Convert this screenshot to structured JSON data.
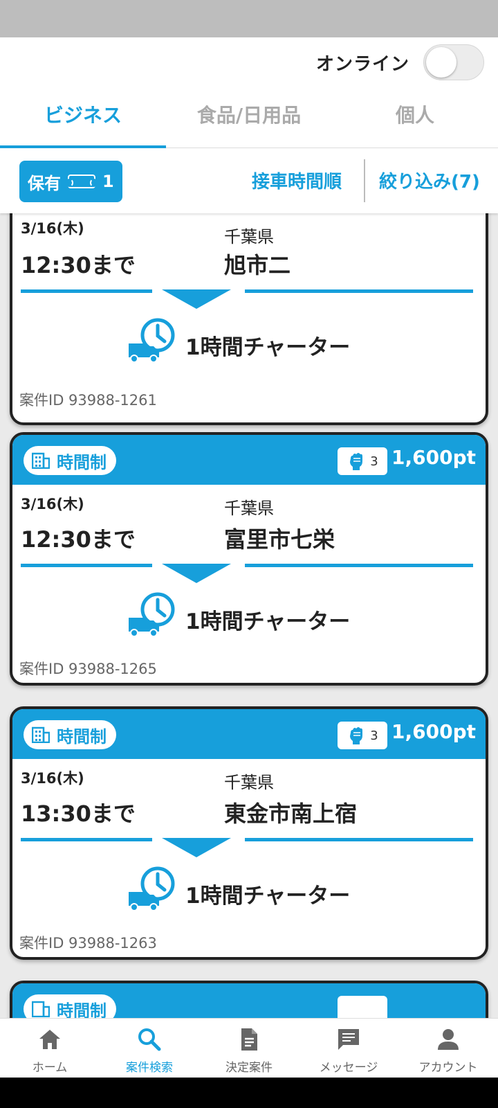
{
  "header": {
    "online_label": "オンライン",
    "online_enabled": false,
    "tabs": [
      {
        "label": "ビジネス",
        "active": true
      },
      {
        "label": "食品/日用品",
        "active": false
      },
      {
        "label": "個人",
        "active": false
      }
    ]
  },
  "filter_bar": {
    "owned_label": "保有",
    "owned_count": "1",
    "sort_label": "接車時間順",
    "filter_label": "絞り込み(7)"
  },
  "cards": [
    {
      "type_label": "",
      "fist_count": "",
      "points": "",
      "date": "3/16(木)",
      "deadline": "12:30まで",
      "prefecture": "千葉県",
      "city": "旭市二",
      "service": "1時間チャーター",
      "case_id": "案件ID 93988-1261"
    },
    {
      "type_label": "時間制",
      "fist_count": "3",
      "points": "1,600pt",
      "date": "3/16(木)",
      "deadline": "12:30まで",
      "prefecture": "千葉県",
      "city": "富里市七栄",
      "service": "1時間チャーター",
      "case_id": "案件ID 93988-1265"
    },
    {
      "type_label": "時間制",
      "fist_count": "3",
      "points": "1,600pt",
      "date": "3/16(木)",
      "deadline": "13:30まで",
      "prefecture": "千葉県",
      "city": "東金市南上宿",
      "service": "1時間チャーター",
      "case_id": "案件ID 93988-1263"
    },
    {
      "type_label": "時間制",
      "fist_count": "",
      "points": ""
    }
  ],
  "bottom_nav": [
    {
      "label": "ホーム",
      "icon": "home-icon",
      "active": false
    },
    {
      "label": "案件検索",
      "icon": "search-icon",
      "active": true
    },
    {
      "label": "決定案件",
      "icon": "document-icon",
      "active": false
    },
    {
      "label": "メッセージ",
      "icon": "message-icon",
      "active": false
    },
    {
      "label": "アカウント",
      "icon": "account-icon",
      "active": false
    }
  ],
  "colors": {
    "accent": "#179fdb",
    "card_border": "#222222",
    "background": "#eaeaea"
  }
}
